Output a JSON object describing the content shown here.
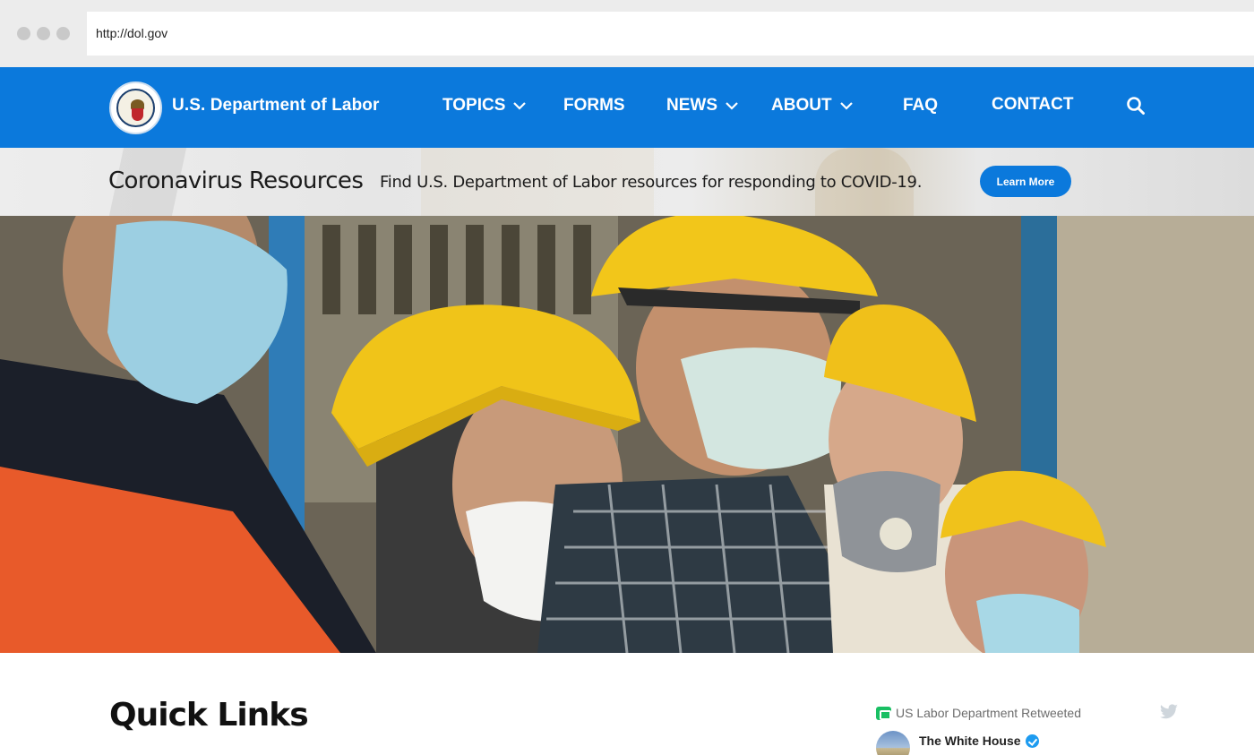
{
  "browser": {
    "url": "http://dol.gov"
  },
  "site": {
    "brand": "U.S. Department of Labor",
    "accent_color": "#0b79dc",
    "nav": [
      {
        "label": "TOPICS",
        "has_dropdown": true
      },
      {
        "label": "FORMS",
        "has_dropdown": false
      },
      {
        "label": "NEWS",
        "has_dropdown": true
      },
      {
        "label": "ABOUT",
        "has_dropdown": true
      },
      {
        "label": "FAQ",
        "has_dropdown": false
      },
      {
        "label": "CONTACT",
        "has_dropdown": false
      }
    ],
    "search_icon": "search-icon"
  },
  "banner": {
    "title": "Coronavirus Resources",
    "text": "Find U.S. Department of Labor resources for responding to COVID-19.",
    "button": "Learn More"
  },
  "main": {
    "quick_links_title": "Quick Links"
  },
  "tweet": {
    "retweet_text": "US Labor Department Retweeted",
    "author": "The White House"
  }
}
